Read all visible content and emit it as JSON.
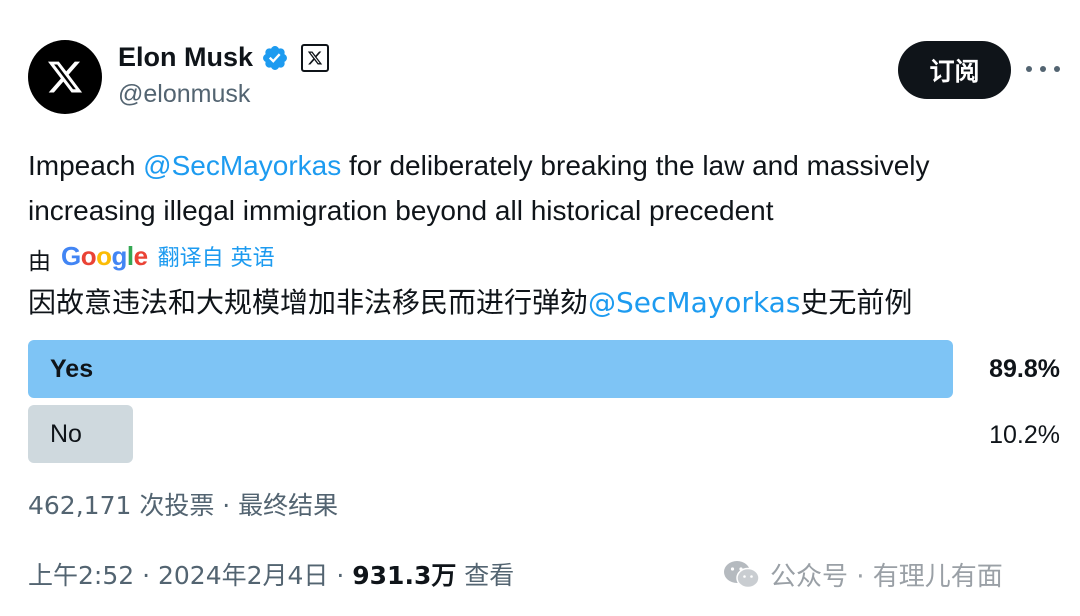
{
  "author": {
    "display_name": "Elon Musk",
    "handle": "@elonmusk",
    "avatar_icon": "x-logo-icon",
    "verified_icon": "verified-badge-icon",
    "affiliate_icon": "x-affiliate-badge-icon"
  },
  "actions": {
    "subscribe_label": "订阅",
    "more_icon": "more-dots-icon"
  },
  "tweet": {
    "text_before": "Impeach ",
    "mention": "@SecMayorkas",
    "text_after": " for deliberately breaking the law and massively increasing illegal immigration beyond all historical precedent"
  },
  "translation": {
    "by_label": "由",
    "provider": "Google",
    "translated_from": "翻译自 英语",
    "text_before": "因故意违法和大规模增加非法移民而进行弹劾",
    "mention": "@SecMayorkas",
    "text_after": "史无前例"
  },
  "poll": {
    "options": [
      {
        "label": "Yes",
        "percent_text": "89.8%",
        "fraction": 0.898,
        "winner": true
      },
      {
        "label": "No",
        "percent_text": "10.2%",
        "fraction": 0.102,
        "winner": false
      }
    ],
    "meta": "462,171 次投票 · 最终结果"
  },
  "footer": {
    "time_date": "上午2:52 · 2024年2月4日 · ",
    "views_count": "931.3万",
    "views_label": " 查看"
  },
  "watermark": {
    "icon": "wechat-icon",
    "text": "公众号 · 有理儿有面"
  },
  "colors": {
    "accent": "#1d9bf0",
    "poll_winner": "#7ec4f5",
    "poll_other": "#cfd9de"
  }
}
